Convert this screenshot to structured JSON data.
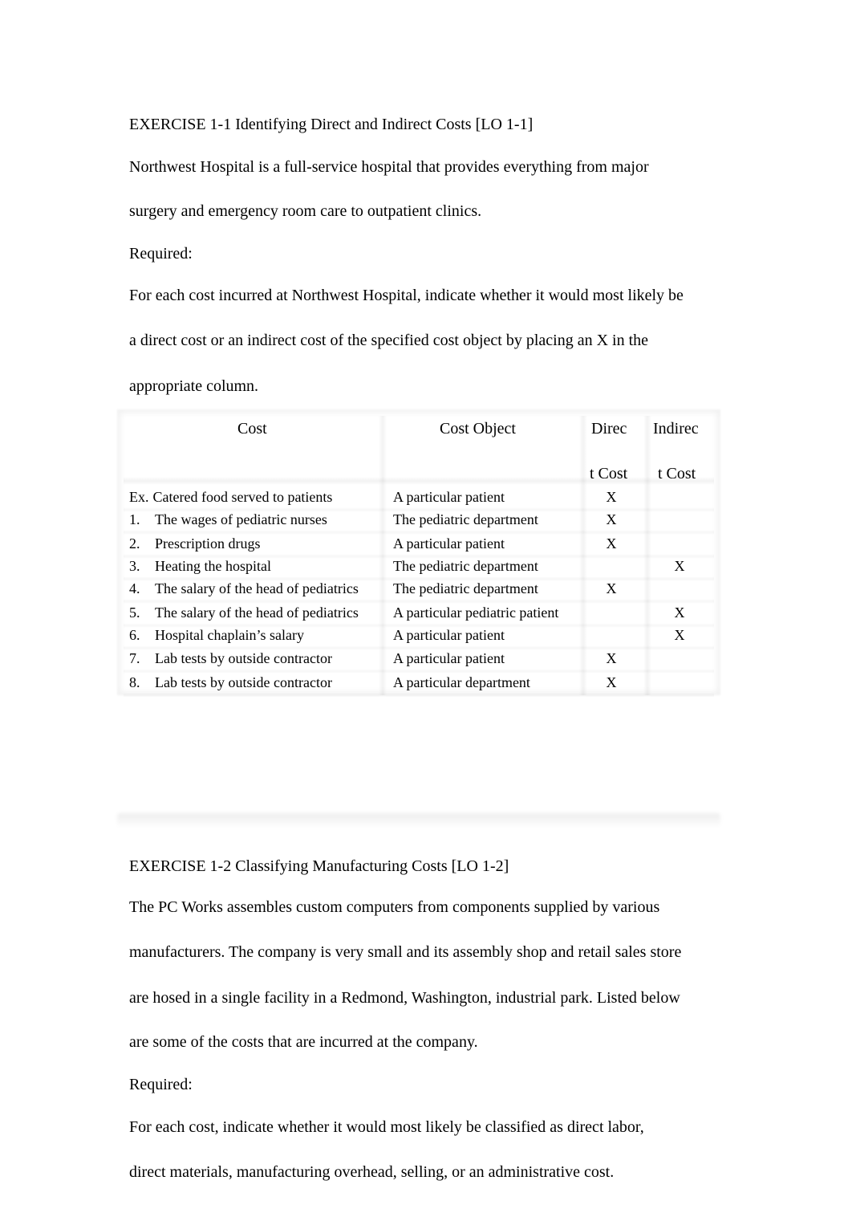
{
  "exercise1": {
    "title": "EXERCISE 1-1 Identifying Direct and Indirect Costs [LO 1-1]",
    "intro_lines": [
      "Northwest Hospital is a full-service hospital that provides everything from major",
      "surgery and emergency room care to outpatient clinics."
    ],
    "required_label": "Required:",
    "instruction_lines": [
      "For each cost incurred at Northwest Hospital, indicate whether it would most likely be",
      "a direct cost or an indirect cost of the specified cost object by placing an X in the",
      "appropriate column."
    ],
    "table": {
      "headers": {
        "cost": "Cost",
        "cost_object": "Cost Object",
        "direct_line1": "Direc",
        "direct_line2": "t Cost",
        "indirect_line1": "Indirec",
        "indirect_line2": "t Cost"
      },
      "rows": [
        {
          "num": "Ex.",
          "cost": "Catered food served to patients",
          "object": "A particular patient",
          "direct": "X",
          "indirect": ""
        },
        {
          "num": "1.",
          "cost": "The wages of pediatric nurses",
          "object": "The pediatric department",
          "direct": "X",
          "indirect": ""
        },
        {
          "num": "2.",
          "cost": "Prescription drugs",
          "object": "A particular patient",
          "direct": "X",
          "indirect": ""
        },
        {
          "num": "3.",
          "cost": "Heating the hospital",
          "object": "The pediatric department",
          "direct": "",
          "indirect": "X"
        },
        {
          "num": "4.",
          "cost": "The salary of the head of pediatrics",
          "object": "The pediatric department",
          "direct": "X",
          "indirect": ""
        },
        {
          "num": "5.",
          "cost": "The salary of the head of pediatrics",
          "object": "A particular pediatric patient",
          "direct": "",
          "indirect": "X"
        },
        {
          "num": "6.",
          "cost": "Hospital chaplain’s salary",
          "object": "A particular patient",
          "direct": "",
          "indirect": "X"
        },
        {
          "num": "7.",
          "cost": "Lab tests by outside contractor",
          "object": "A particular patient",
          "direct": "X",
          "indirect": ""
        },
        {
          "num": "8.",
          "cost": "Lab tests by outside contractor",
          "object": "A particular department",
          "direct": "X",
          "indirect": ""
        }
      ]
    }
  },
  "exercise2": {
    "title": "EXERCISE 1-2 Classifying Manufacturing Costs [LO 1-2]",
    "intro_lines": [
      "The PC Works assembles custom computers from components supplied by various",
      "manufacturers. The company is very small and its assembly shop and retail sales store",
      "are hosed in a single facility in a Redmond, Washington, industrial park. Listed below",
      "are some of the costs that are incurred at the company."
    ],
    "required_label": "Required:",
    "instruction_lines": [
      "For each cost, indicate whether it would most likely be classified as direct labor,",
      "direct materials, manufacturing overhead, selling, or an administrative cost."
    ]
  }
}
